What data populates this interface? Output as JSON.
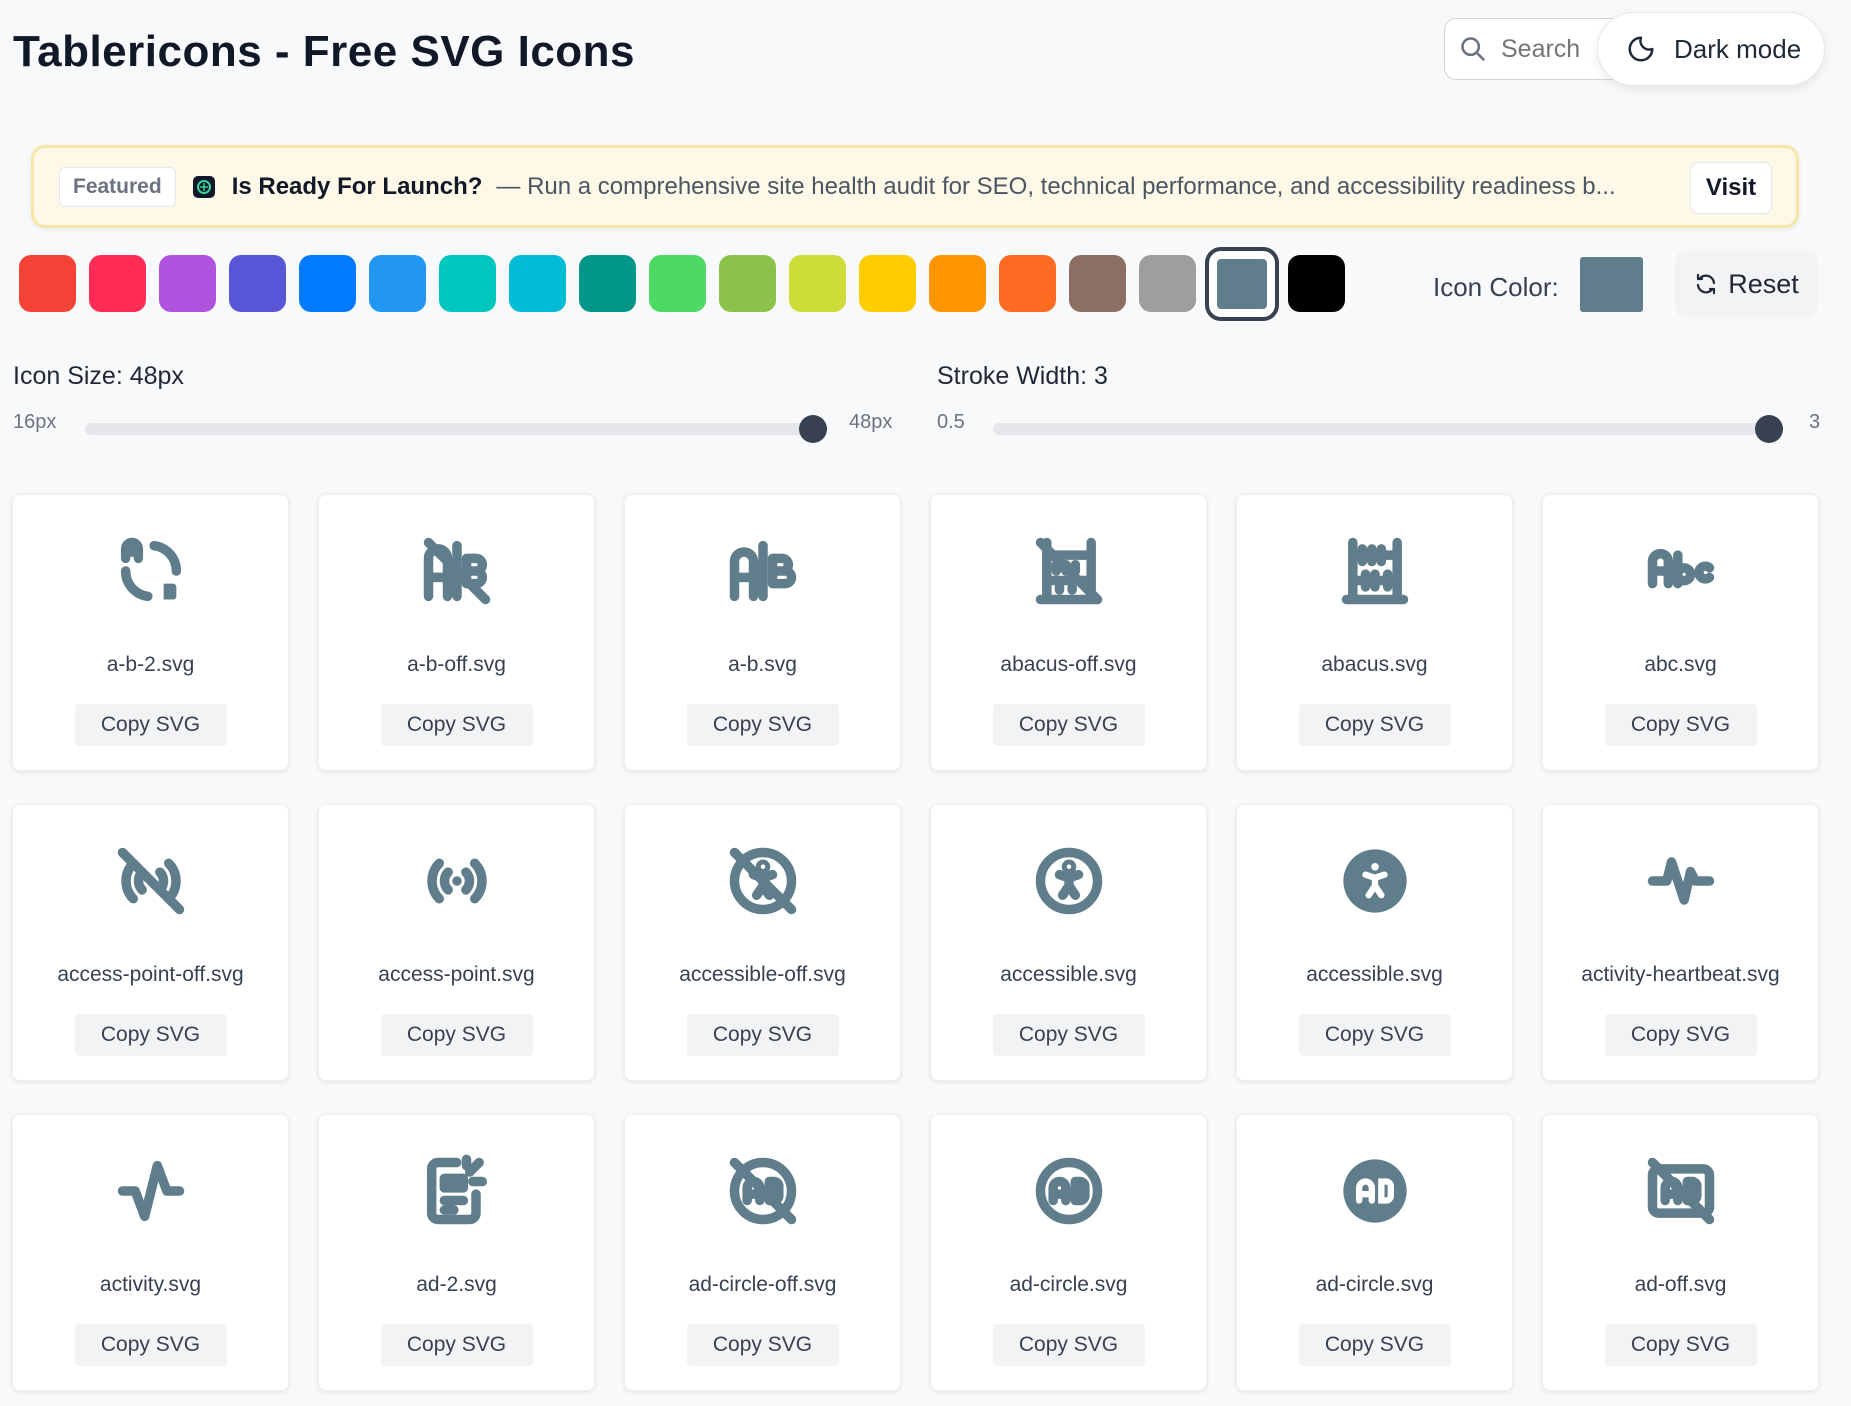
{
  "header": {
    "title": "Tablericons - Free SVG Icons",
    "search_placeholder": "Search",
    "dark_mode_label": "Dark mode"
  },
  "banner": {
    "badge": "Featured",
    "title": "Is Ready For Launch?",
    "description": "— Run a comprehensive site health audit for SEO, technical performance, and accessibility readiness b...",
    "visit_label": "Visit"
  },
  "palette": {
    "colors": [
      "#f44336",
      "#ff2d55",
      "#af52de",
      "#5856d6",
      "#007aff",
      "#2196f3",
      "#00c7be",
      "#00bcd4",
      "#009688",
      "#4cd964",
      "#8bc34a",
      "#cddc39",
      "#ffcc00",
      "#ff9500",
      "#ff6b22",
      "#8d6e63",
      "#9e9e9e",
      "#607d8b",
      "#000000"
    ],
    "selected": "#607d8b",
    "icon_color_label": "Icon Color:",
    "reset_label": "Reset"
  },
  "size_slider": {
    "label": "Icon Size: 48px",
    "min_label": "16px",
    "max_label": "48px",
    "value": 1.0
  },
  "stroke_slider": {
    "label": "Stroke Width: 3",
    "min_label": "0.5",
    "max_label": "3",
    "value": 1.0
  },
  "copy_label": "Copy SVG",
  "icons": [
    {
      "name": "a-b-2.svg",
      "icon": "a-b-2-icon"
    },
    {
      "name": "a-b-off.svg",
      "icon": "a-b-off-icon"
    },
    {
      "name": "a-b.svg",
      "icon": "a-b-icon"
    },
    {
      "name": "abacus-off.svg",
      "icon": "abacus-off-icon"
    },
    {
      "name": "abacus.svg",
      "icon": "abacus-icon"
    },
    {
      "name": "abc.svg",
      "icon": "abc-icon"
    },
    {
      "name": "access-point-off.svg",
      "icon": "access-point-off-icon"
    },
    {
      "name": "access-point.svg",
      "icon": "access-point-icon"
    },
    {
      "name": "accessible-off.svg",
      "icon": "accessible-off-icon"
    },
    {
      "name": "accessible.svg",
      "icon": "accessible-icon"
    },
    {
      "name": "accessible.svg",
      "icon": "accessible-filled-icon"
    },
    {
      "name": "activity-heartbeat.svg",
      "icon": "activity-heartbeat-icon"
    },
    {
      "name": "activity.svg",
      "icon": "activity-icon"
    },
    {
      "name": "ad-2.svg",
      "icon": "ad-2-icon"
    },
    {
      "name": "ad-circle-off.svg",
      "icon": "ad-circle-off-icon"
    },
    {
      "name": "ad-circle.svg",
      "icon": "ad-circle-icon"
    },
    {
      "name": "ad-circle.svg",
      "icon": "ad-circle-filled-icon"
    },
    {
      "name": "ad-off.svg",
      "icon": "ad-off-icon"
    }
  ]
}
